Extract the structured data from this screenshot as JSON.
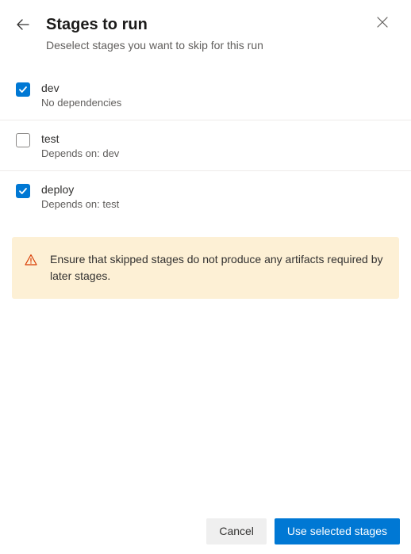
{
  "header": {
    "title": "Stages to run",
    "subtitle": "Deselect stages you want to skip for this run"
  },
  "stages": [
    {
      "name": "dev",
      "dependency": "No dependencies",
      "checked": true
    },
    {
      "name": "test",
      "dependency": "Depends on: dev",
      "checked": false
    },
    {
      "name": "deploy",
      "dependency": "Depends on: test",
      "checked": true
    }
  ],
  "warning": {
    "text": "Ensure that skipped stages do not produce any artifacts required by later stages."
  },
  "footer": {
    "cancel_label": "Cancel",
    "primary_label": "Use selected stages"
  },
  "colors": {
    "accent": "#0078d4",
    "warning_bg": "#fdf0d5",
    "warning_icon": "#d83b01"
  }
}
